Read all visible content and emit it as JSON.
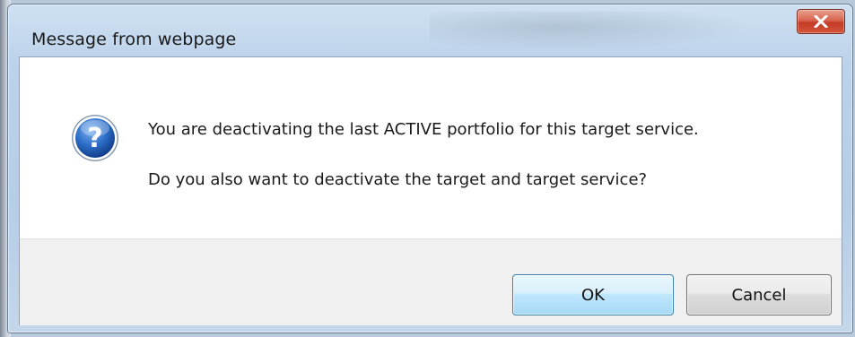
{
  "window": {
    "title": "Message from webpage",
    "close_icon": "close-icon"
  },
  "message": {
    "icon": "question-icon",
    "line1": "You are deactivating the last ACTIVE portfolio for this target service.",
    "line2": "Do you also want to deactivate the target and target service?"
  },
  "buttons": {
    "ok_label": "OK",
    "cancel_label": "Cancel"
  },
  "colors": {
    "close_button": "#c43b25",
    "ok_button": "#bee6fd",
    "question_icon": "#1f5fb8"
  }
}
